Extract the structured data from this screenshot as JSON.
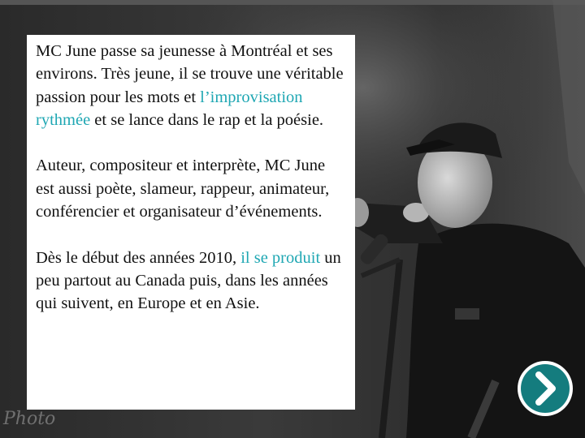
{
  "slide": {
    "paragraphs": [
      {
        "before": "MC June passe sa jeunesse à Montréal et ses environs. Très jeune, il se trouve une véritable passion pour les mots et ",
        "link": "l’improvisation rythmée",
        "after": " et se lance dans le rap et la poésie."
      },
      {
        "text": "Auteur, compositeur et interprète, MC June est aussi poète, slameur, rappeur, animateur, conférencier et organisateur d’événements."
      },
      {
        "before": "Dès le début des années 2010, ",
        "link": "il se produit",
        "after": " un peu partout au Canada puis, dans les années qui suivent, en Europe et en Asie."
      }
    ],
    "watermark": "Photo",
    "next_icon": "chevron-right-icon"
  },
  "colors": {
    "link": "#1fa7b3",
    "next_button": "#147c7e"
  }
}
